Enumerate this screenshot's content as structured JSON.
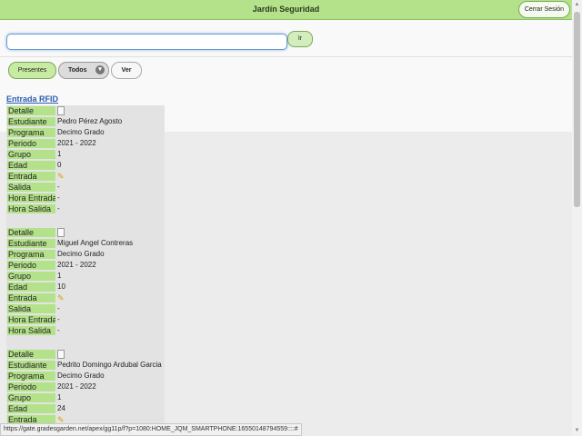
{
  "header": {
    "title": "Jardín Seguridad",
    "logout_label": "Cerrar Sesión"
  },
  "search": {
    "value": "",
    "go_label": "Ir"
  },
  "filters": [
    {
      "label": "Presentes",
      "active": true
    },
    {
      "label": "Todos",
      "active": false
    },
    {
      "label": "Ver",
      "active": false
    }
  ],
  "section": {
    "title": "Entrada RFID"
  },
  "labels": {
    "detalle": "Detalle",
    "estudiante": "Estudiante",
    "programa": "Programa",
    "periodo": "Periodo",
    "grupo": "Grupo",
    "edad": "Edad",
    "entrada": "Entrada",
    "salida": "Salida",
    "hora_entrada": "Hora Entrada",
    "hora_salida": "Hora Salida"
  },
  "records": [
    {
      "estudiante": "Pedro Pérez Agosto",
      "programa": "Decimo Grado",
      "periodo": "2021 - 2022",
      "grupo": "1",
      "edad": "0",
      "salida": "-",
      "hora_entrada": "-",
      "hora_salida": "-"
    },
    {
      "estudiante": "Miguel Angel Contreras",
      "programa": "Decimo Grado",
      "periodo": "2021 - 2022",
      "grupo": "1",
      "edad": "10",
      "salida": "-",
      "hora_entrada": "-",
      "hora_salida": "-"
    },
    {
      "estudiante": "Pedrito Domingo Ardubal Garcia",
      "programa": "Decimo Grado",
      "periodo": "2021 - 2022",
      "grupo": "1",
      "edad": "24",
      "salida": "",
      "hora_entrada": "",
      "hora_salida": ""
    }
  ],
  "status": {
    "url": "https://gate.gradesgarden.net/apex/gg11p/f?p=1080:HOME_JQM_SMARTPHONE:16550148794559::::#"
  }
}
